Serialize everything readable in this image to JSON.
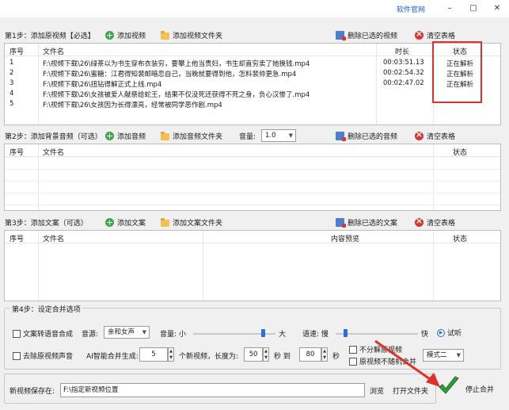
{
  "window": {
    "official_link": "软件官网",
    "minimize": "–",
    "maximize": "□",
    "close": "✕"
  },
  "step1": {
    "label": "第1步：添加原视频【必选】",
    "add_btn": "添加视频",
    "add_folder_btn": "添加视频文件夹",
    "delete_btn": "删除已选的视频",
    "clear_btn": "清空表格",
    "columns": {
      "index": "序号",
      "filename": "文件名",
      "duration": "时长",
      "status": "状态"
    },
    "rows": [
      {
        "index": "1",
        "filename": "F:\\视频下载\\26\\绿茶以为书生穿布衣装穷，要攀上他当贵妇，书生却直穷卖了她换钱.mp4",
        "duration": "00:03:51.13",
        "status": "正在解析"
      },
      {
        "index": "2",
        "filename": "F:\\视频下载\\26\\蜜糖：江君得知裴邮暗恋自己，当晚就要得到他，怎料裴帅更急.mp4",
        "duration": "00:02:54.32",
        "status": "正在解析"
      },
      {
        "index": "3",
        "filename": "F:\\视频下载\\26\\扭钻得解正式上线.mp4",
        "duration": "00:02:47.02",
        "status": "正在解析"
      },
      {
        "index": "4",
        "filename": "F:\\视频下载\\26\\女孩被爱人献祭给蛇王，结果不仅没死还获得不死之身，负心汉惨了.mp4",
        "duration": "",
        "status": ""
      },
      {
        "index": "5",
        "filename": "F:\\视频下载\\26\\女孩因为长得漂亮，经常被同学恶作剧.mp4",
        "duration": "",
        "status": ""
      }
    ]
  },
  "step2": {
    "label": "第2步：添加背景音频（可选）",
    "add_btn": "添加音频",
    "add_folder_btn": "添加音频文件夹",
    "volume_label": "音量:",
    "volume_value": "1.0",
    "delete_btn": "删除已选的音频",
    "clear_btn": "清空表格",
    "columns": {
      "index": "序号",
      "filename": "文件名",
      "status": "状态"
    }
  },
  "step3": {
    "label": "第3步：添加文案（可选）",
    "add_btn": "添加文案",
    "add_folder_btn": "添加文案文件夹",
    "delete_btn": "删除已选的文案",
    "clear_btn": "清空表格",
    "columns": {
      "index": "序号",
      "filename": "文件名",
      "preview": "内容预览",
      "status": "状态"
    }
  },
  "step4": {
    "label": "第4步：设定合并选项",
    "tts_checkbox": "文案转语音合成",
    "voice_label": "音源:",
    "voice_value": "亲和女声",
    "volume_label": "音量: 小",
    "volume_big": "大",
    "volume_level": 0.85,
    "speed_label": "语速: 慢",
    "speed_fast": "快",
    "speed_level": 0.12,
    "listen_btn": "试听",
    "mute_checkbox": "去除原视频声音",
    "ai_label": "AI智能合并生成:",
    "count_value": "5",
    "count_suffix": "个新视频，长度为:",
    "min_value": "50",
    "sec_to": "秒 到",
    "max_value": "80",
    "sec": "秒",
    "no_split_checkbox": "不分解原视频",
    "no_repeat_checkbox": "原视频不随机合并",
    "mode_value": "模式二"
  },
  "save": {
    "label": "新视频保存在:",
    "path": "F:\\指定新视频位置",
    "browse_btn": "浏览",
    "open_folder_btn": "打开文件夹",
    "stop_btn": "停止合并"
  }
}
